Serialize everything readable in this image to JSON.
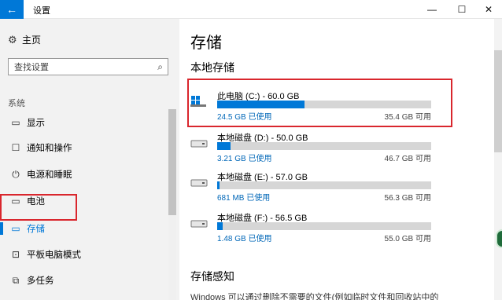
{
  "window": {
    "title": "设置",
    "back_icon": "arrow-left-icon",
    "minimize": "—",
    "maximize": "☐",
    "close": "✕"
  },
  "sidebar": {
    "home_label": "主页",
    "search_placeholder": "查找设置",
    "section_label": "系统",
    "items": [
      {
        "label": "显示",
        "icon": "monitor-icon",
        "glyph": "▭",
        "active": false
      },
      {
        "label": "通知和操作",
        "icon": "notification-icon",
        "glyph": "☐",
        "active": false
      },
      {
        "label": "电源和睡眠",
        "icon": "power-icon",
        "glyph": "⏻",
        "active": false
      },
      {
        "label": "电池",
        "icon": "battery-icon",
        "glyph": "▭",
        "active": false
      },
      {
        "label": "存储",
        "icon": "storage-icon",
        "glyph": "▭",
        "active": true
      },
      {
        "label": "平板电脑模式",
        "icon": "tablet-icon",
        "glyph": "⊡",
        "active": false
      },
      {
        "label": "多任务",
        "icon": "multitask-icon",
        "glyph": "⧉",
        "active": false
      }
    ]
  },
  "main": {
    "title": "存储",
    "local_storage_title": "本地存储",
    "drives": [
      {
        "name": "此电脑 (C:) - 60.0 GB",
        "used": "24.5 GB 已使用",
        "free": "35.4 GB 可用",
        "used_fraction": 0.408,
        "icon": "windows-drive-icon"
      },
      {
        "name": "本地磁盘 (D:) - 50.0 GB",
        "used": "3.21 GB 已使用",
        "free": "46.7 GB 可用",
        "used_fraction": 0.064,
        "icon": "hard-drive-icon"
      },
      {
        "name": "本地磁盘 (E:) - 57.0 GB",
        "used": "681 MB 已使用",
        "free": "56.3 GB 可用",
        "used_fraction": 0.012,
        "icon": "hard-drive-icon"
      },
      {
        "name": "本地磁盘 (F:) - 56.5 GB",
        "used": "1.48 GB 已使用",
        "free": "55.0 GB 可用",
        "used_fraction": 0.026,
        "icon": "hard-drive-icon"
      }
    ],
    "storage_sense_title": "存储感知",
    "storage_sense_desc": "Windows 可以通过删除不需要的文件(例如临时文件和回收站中的"
  },
  "colors": {
    "accent": "#0078d7",
    "highlight": "#d9262d"
  }
}
